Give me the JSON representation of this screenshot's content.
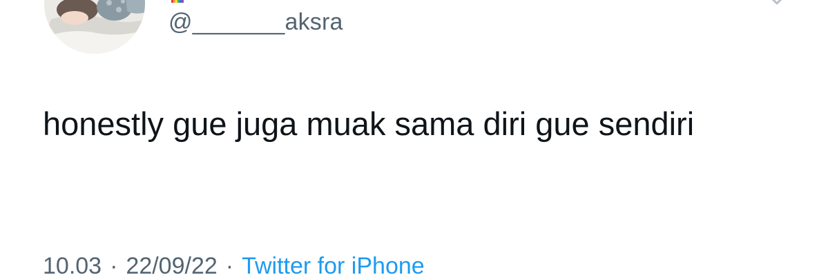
{
  "tweet": {
    "handle": "@_______aksra",
    "text": "honestly gue juga muak sama diri gue sendiri",
    "time": "10.03",
    "date": "22/09/22",
    "separator": "·",
    "source": "Twitter for iPhone"
  },
  "icons": {
    "avatar": "profile-picture",
    "flag": "rainbow-flag-icon",
    "menu": "chevron-down-icon"
  },
  "colors": {
    "text": "#0f1419",
    "secondary": "#536471",
    "link": "#1d9bf0",
    "background": "#ffffff"
  }
}
